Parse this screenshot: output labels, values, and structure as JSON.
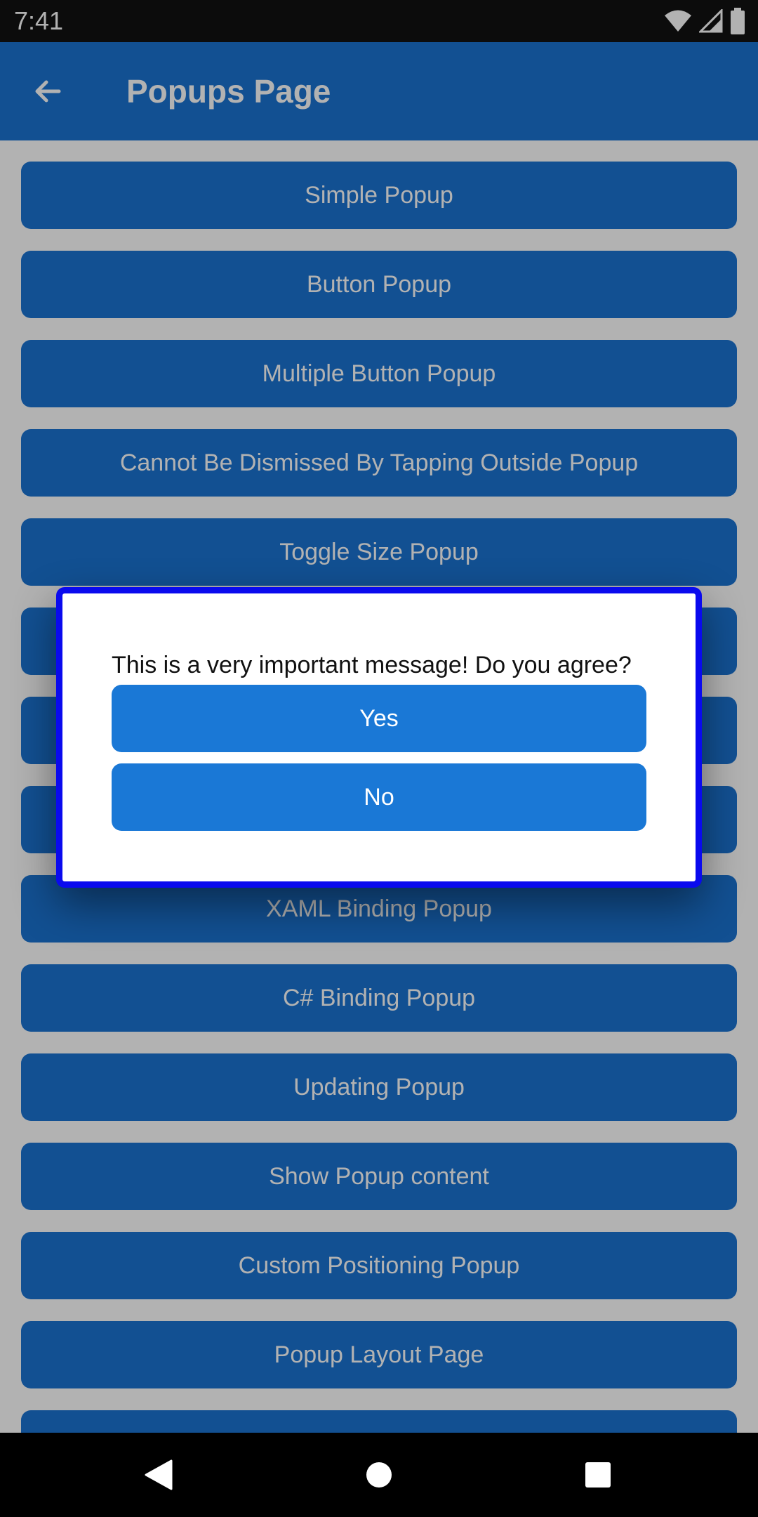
{
  "status_bar": {
    "time": "7:41",
    "icons": [
      "wifi-icon",
      "signal-icon",
      "battery-icon"
    ]
  },
  "app_bar": {
    "title": "Popups Page",
    "back_icon": "arrow-left-icon",
    "background": "#1a73d2"
  },
  "menu": {
    "items": [
      {
        "label": "Simple Popup"
      },
      {
        "label": "Button Popup"
      },
      {
        "label": "Multiple Button Popup"
      },
      {
        "label": "Cannot Be Dismissed By Tapping Outside Popup"
      },
      {
        "label": "Toggle Size Popup"
      },
      {
        "label": ""
      },
      {
        "label": ""
      },
      {
        "label": ""
      },
      {
        "label": "XAML Binding Popup"
      },
      {
        "label": "C# Binding Popup"
      },
      {
        "label": "Updating Popup"
      },
      {
        "label": "Show Popup content"
      },
      {
        "label": "Custom Positioning Popup"
      },
      {
        "label": "Popup Layout Page"
      }
    ]
  },
  "dialog": {
    "message": "This is a very important message! Do you agree?",
    "yes_label": "Yes",
    "no_label": "No",
    "border_color": "#0a0aee",
    "button_color": "#1a78d6"
  },
  "nav_bar": {
    "icons": [
      "back-triangle-icon",
      "home-circle-icon",
      "recents-square-icon"
    ]
  }
}
